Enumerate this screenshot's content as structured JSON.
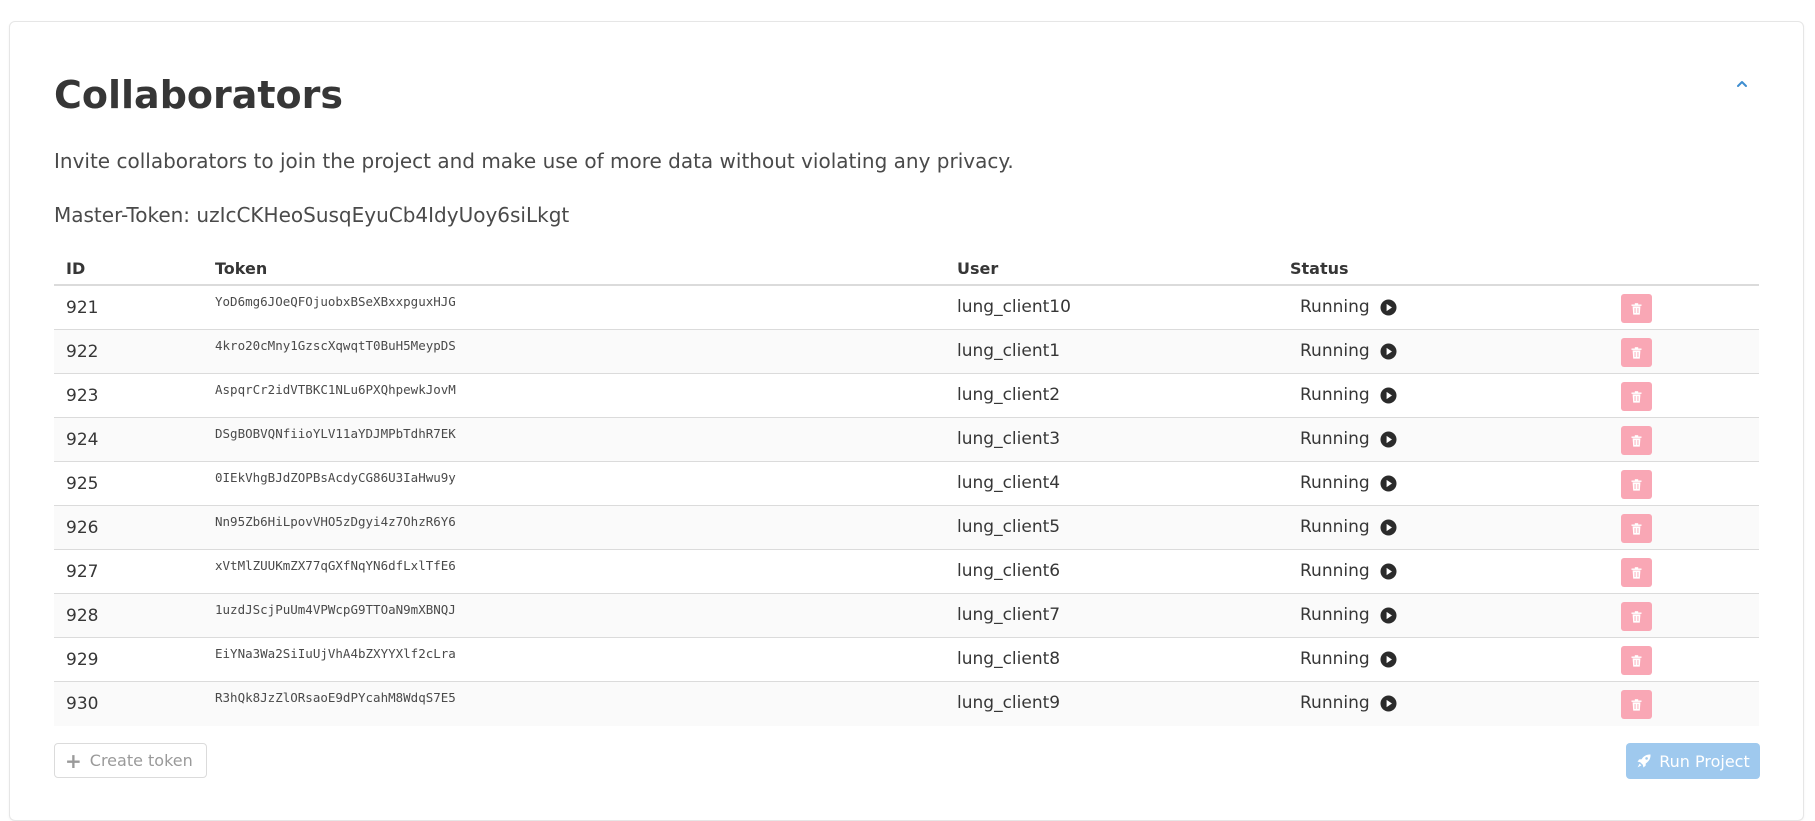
{
  "section": {
    "title": "Collaborators",
    "description": "Invite collaborators to join the project and make use of more data without violating any privacy.",
    "master_token": "Master-Token: uzIcCKHeoSusqEyuCb4IdyUoy6siLkgt"
  },
  "table": {
    "headers": {
      "id": "ID",
      "token": "Token",
      "user": "User",
      "status": "Status"
    },
    "rows": [
      {
        "id": "921",
        "token": "YoD6mg6JOeQFOjuobxBSeXBxxpguxHJG",
        "user": "lung_client10",
        "status": "Running"
      },
      {
        "id": "922",
        "token": "4kro20cMny1GzscXqwqtT0BuH5MeypDS",
        "user": "lung_client1",
        "status": "Running"
      },
      {
        "id": "923",
        "token": "AspqrCr2idVTBKC1NLu6PXQhpewkJovM",
        "user": "lung_client2",
        "status": "Running"
      },
      {
        "id": "924",
        "token": "DSgBOBVQNfiioYLV11aYDJMPbTdhR7EK",
        "user": "lung_client3",
        "status": "Running"
      },
      {
        "id": "925",
        "token": "0IEkVhgBJdZOPBsAcdyCG86U3IaHwu9y",
        "user": "lung_client4",
        "status": "Running"
      },
      {
        "id": "926",
        "token": "Nn95Zb6HiLpovVHO5zDgyi4z7OhzR6Y6",
        "user": "lung_client5",
        "status": "Running"
      },
      {
        "id": "927",
        "token": "xVtMlZUUKmZX77qGXfNqYN6dfLxlTfE6",
        "user": "lung_client6",
        "status": "Running"
      },
      {
        "id": "928",
        "token": "1uzdJScjPuUm4VPWcpG9TTOaN9mXBNQJ",
        "user": "lung_client7",
        "status": "Running"
      },
      {
        "id": "929",
        "token": "EiYNa3Wa2SiIuUjVhA4bZXYYXlf2cLra",
        "user": "lung_client8",
        "status": "Running"
      },
      {
        "id": "930",
        "token": "R3hQk8JzZlORsaoE9dPYcahM8WdqS7E5",
        "user": "lung_client9",
        "status": "Running"
      }
    ]
  },
  "actions": {
    "create_token_label": "Create token",
    "run_project_label": "Run Project"
  },
  "icons": {
    "collapse": "chevron-up-icon",
    "status_action": "play-circle-icon",
    "delete": "trash-icon",
    "create": "plus-icon",
    "run": "rocket-icon"
  },
  "colors": {
    "accent": "#3e8ed0",
    "danger_light": "#f9a7b5",
    "primary_light": "#9fc9ee"
  }
}
